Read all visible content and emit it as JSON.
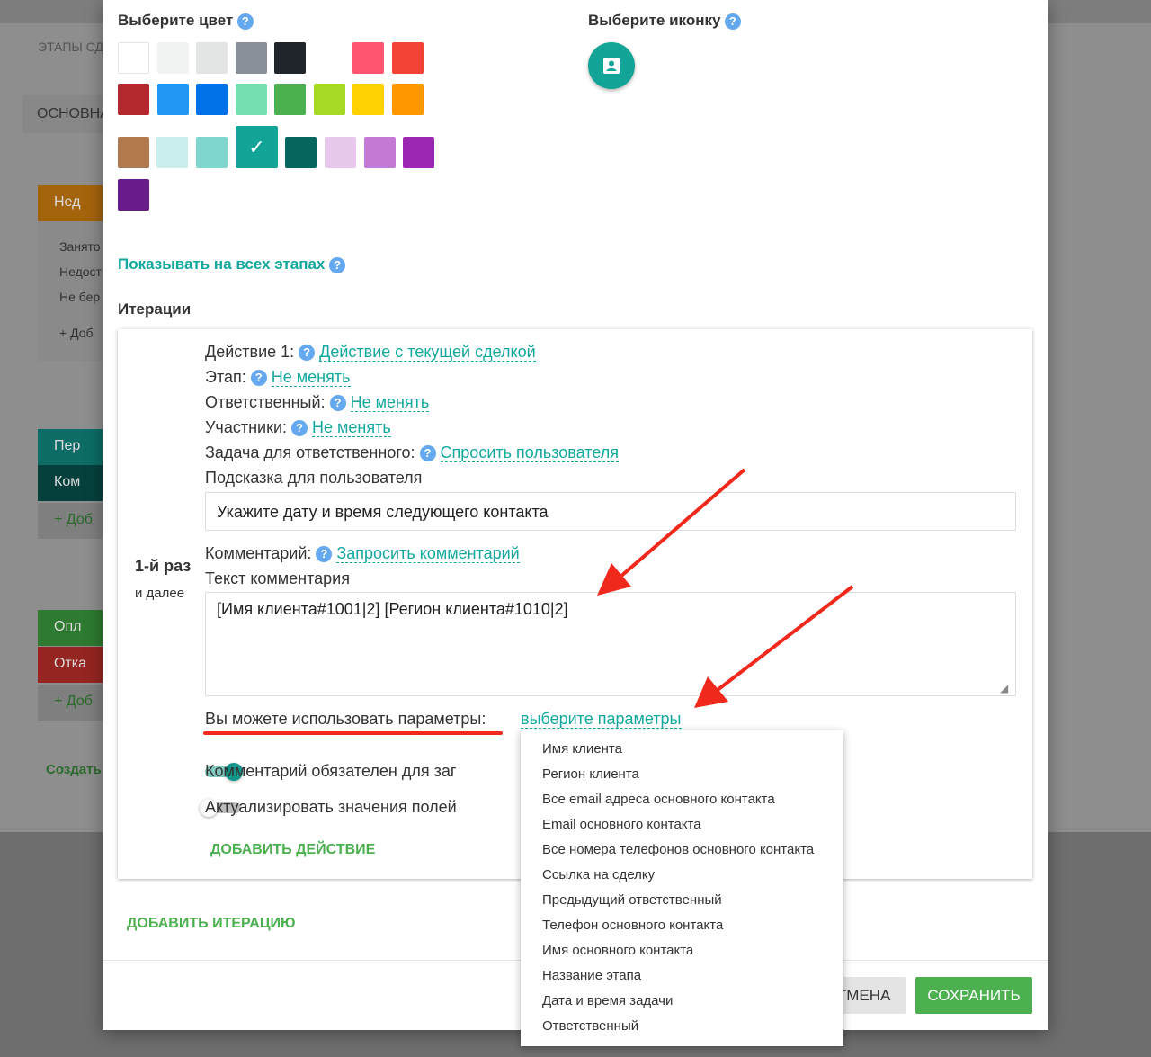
{
  "background": {
    "tab": "ЭТАПЫ СД",
    "section": "ОСНОВНА",
    "stage1": {
      "label": "Нед",
      "items": [
        "Занято",
        "Недост",
        "Не бер"
      ],
      "add": "Доб"
    },
    "stage2": {
      "items": [
        "Пер",
        "Ком"
      ],
      "add": "Доб"
    },
    "stage3": {
      "items": [
        "Опл",
        "Отка"
      ],
      "add": "Доб"
    },
    "create": "Создать"
  },
  "color_picker": {
    "title": "Выберите цвет",
    "help": "?",
    "colors": [
      "#ffffff",
      "#f1f2f2",
      "#e3e4e4",
      "#8a9099",
      "#20242b",
      null,
      "#fe5670",
      "#f44336",
      "#b3282e",
      "#2196f3",
      "#0071e6",
      "#74e0b0",
      "#4caf50",
      "#a6d925",
      "#ffd100",
      "#ff9800",
      "#b07a4e",
      "#c9eeec",
      "#80d6cf",
      "#12a597",
      "#07655f",
      "#e8c8ec",
      "#c479d4",
      "#9c27b0",
      "#6a1b8a"
    ],
    "selected": "#12a597"
  },
  "icon_picker": {
    "title": "Выберите иконку",
    "help": "?",
    "icon": "contact-card-icon",
    "color": "#12a597"
  },
  "show_all": "Показывать на всех этапах",
  "iterations_title": "Итерации",
  "iteration": {
    "label": "1-й раз",
    "sublabel": "и далее",
    "action_label": "Действие 1:",
    "action_value": "Действие с текущей сделкой",
    "stage_label": "Этап:",
    "stage_value": "Не менять",
    "resp_label": "Ответственный:",
    "resp_value": "Не менять",
    "part_label": "Участники:",
    "part_value": "Не менять",
    "task_label": "Задача для ответственного:",
    "task_value": "Спросить пользователя",
    "hint_label": "Подсказка для пользователя",
    "hint_value": "Укажите дату и время следующего контакта",
    "comment_label": "Комментарий:",
    "comment_value": "Запросить комментарий",
    "text_label": "Текст комментария",
    "text_value": "[Имя клиента#1001|2] [Регион клиента#1010|2]",
    "params_label": "Вы можете использовать параметры:",
    "params_link": "выберите параметры",
    "toggle1": {
      "label": "Комментарий обязателен для заг",
      "on": true
    },
    "toggle2": {
      "label": "Актуализировать значения полей",
      "on": false
    },
    "add_action": "ДОБАВИТЬ ДЕЙСТВИЕ"
  },
  "add_iteration": "ДОБАВИТЬ ИТЕРАЦИЮ",
  "params_menu": [
    "Имя клиента",
    "Регион клиента",
    "Все email адреса основного контакта",
    "Email основного контакта",
    "Все номера телефонов основного контакта",
    "Ссылка на сделку",
    "Предыдущий ответственный",
    "Телефон основного контакта",
    "Имя основного контакта",
    "Название этапа",
    "Дата и время задачи",
    "Ответственный"
  ],
  "footer": {
    "cancel": "ОТМЕНА",
    "save": "СОХРАНИТЬ"
  },
  "accent": "#13a89e",
  "annotation_color": "#f0291c"
}
